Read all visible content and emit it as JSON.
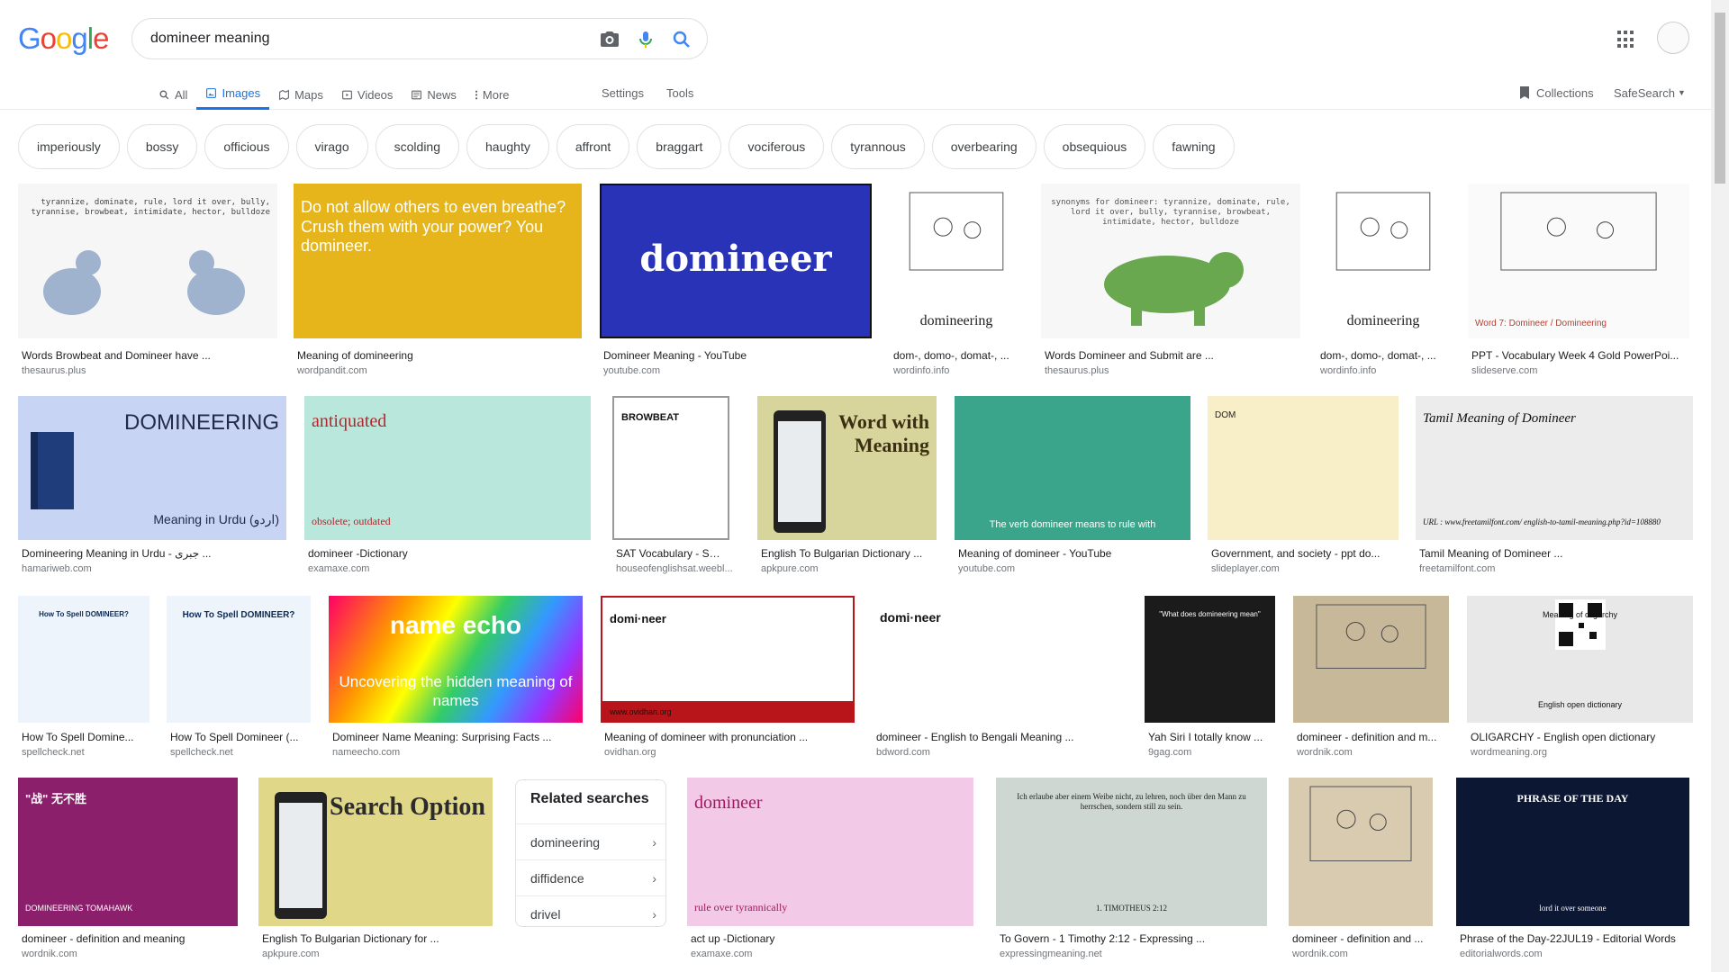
{
  "logo": [
    "G",
    "o",
    "o",
    "g",
    "l",
    "e"
  ],
  "logo_colors": [
    "#4285f4",
    "#ea4335",
    "#fbbc05",
    "#4285f4",
    "#34a853",
    "#ea4335"
  ],
  "search": {
    "query": "domineer meaning"
  },
  "tabs": [
    {
      "label": "All",
      "icon": "search-icon"
    },
    {
      "label": "Images",
      "icon": "image-icon"
    },
    {
      "label": "Maps",
      "icon": "map-icon"
    },
    {
      "label": "Videos",
      "icon": "video-icon"
    },
    {
      "label": "News",
      "icon": "news-icon"
    },
    {
      "label": "More",
      "icon": "more-icon"
    }
  ],
  "tools": {
    "settings": "Settings",
    "tools": "Tools",
    "collections": "Collections",
    "safesearch": "SafeSearch"
  },
  "chips": [
    "imperiously",
    "bossy",
    "officious",
    "virago",
    "scolding",
    "haughty",
    "affront",
    "braggart",
    "vociferous",
    "tyrannous",
    "overbearing",
    "obsequious",
    "fawning"
  ],
  "row1": [
    {
      "caption": "Words Browbeat and Domineer have ...",
      "source": "thesaurus.plus",
      "text": "tyrannize, dominate, rule, lord it over, bully, tyrannise, browbeat, intimidate, hector, bulldoze"
    },
    {
      "caption": "Meaning of domineering",
      "source": "wordpandit.com",
      "text": "Do not allow others to even breathe? Crush them with your power? You domineer."
    },
    {
      "caption": "Domineer Meaning - YouTube",
      "source": "youtube.com",
      "text": "domineer"
    },
    {
      "caption": "dom-, domo-, domat-, ...",
      "source": "wordinfo.info",
      "text": "domineering"
    },
    {
      "caption": "Words Domineer and Submit are ...",
      "source": "thesaurus.plus",
      "text": "synonyms for domineer: tyrannize, dominate, rule, lord it over, bully, tyrannise, browbeat, intimidate, hector, bulldoze"
    },
    {
      "caption": "dom-, domo-, domat-, ...",
      "source": "wordinfo.info",
      "text": "domineering"
    },
    {
      "caption": "PPT - Vocabulary Week 4 Gold PowerPoi...",
      "source": "slideserve.com",
      "text": "Word 7: Domineer / Domineering"
    }
  ],
  "row2": [
    {
      "caption": "Domineering Meaning in Urdu - جبری ...",
      "source": "hamariweb.com",
      "text": "DOMINEERING",
      "text2": "Meaning in Urdu (اردو)"
    },
    {
      "caption": "domineer -Dictionary",
      "source": "examaxe.com",
      "text": "antiquated",
      "text2": "obsolete; outdated"
    },
    {
      "caption": "SAT Vocabulary - SAT...",
      "source": "houseofenglishsat.weebl...",
      "text": "BROWBEAT"
    },
    {
      "caption": "English To Bulgarian Dictionary ...",
      "source": "apkpure.com",
      "text": "Word with Meaning"
    },
    {
      "caption": "Meaning of domineer - YouTube",
      "source": "youtube.com",
      "text": "The verb domineer means to rule with"
    },
    {
      "caption": "Government, and society - ppt do...",
      "source": "slideplayer.com",
      "text": "DOM"
    },
    {
      "caption": "Tamil Meaning of Domineer ...",
      "source": "freetamilfont.com",
      "text": "Tamil Meaning of Domineer",
      "text2": "URL : www.freetamilfont.com/ english-to-tamil-meaning.php?id=108880"
    }
  ],
  "row3": [
    {
      "caption": "How To Spell Domine...",
      "source": "spellcheck.net",
      "text": "How To Spell DOMINEER?"
    },
    {
      "caption": "How To Spell Domineer (...",
      "source": "spellcheck.net",
      "text": "How To Spell DOMINEER?"
    },
    {
      "caption": "Domineer Name Meaning: Surprising Facts ...",
      "source": "nameecho.com",
      "text": "name echo",
      "text2": "Uncovering the hidden meaning of names"
    },
    {
      "caption": "Meaning of domineer with pronunciation ...",
      "source": "ovidhan.org",
      "text": "domi·neer",
      "text2": "www.ovidhan.org"
    },
    {
      "caption": "domineer - English to Bengali Meaning ...",
      "source": "bdword.com",
      "text": "domi·neer"
    },
    {
      "caption": "Yah Siri I totally know ...",
      "source": "9gag.com",
      "text": "\"What does domineering mean\""
    },
    {
      "caption": "domineer - definition and m...",
      "source": "wordnik.com",
      "text": ""
    },
    {
      "caption": "OLIGARCHY - English open dictionary",
      "source": "wordmeaning.org",
      "text": "Meaning of oligarchy",
      "text2": "English open dictionary"
    }
  ],
  "row4": [
    {
      "caption": "domineer - definition and meaning",
      "source": "wordnik.com",
      "text": "\"战\" 无不胜",
      "text2": "DOMINEERING TOMAHAWK"
    },
    {
      "caption": "English To Bulgarian Dictionary for ...",
      "source": "apkpure.com",
      "text": "Search Option"
    },
    {
      "caption": "act up -Dictionary",
      "source": "examaxe.com",
      "text": "domineer",
      "text2": "rule over tyrannically"
    },
    {
      "caption": "To Govern - 1 Timothy 2:12 - Expressing ...",
      "source": "expressingmeaning.net",
      "text": "Ich erlaube aber einem Weibe nicht, zu lehren, noch über den Mann zu herrschen, sondern still zu sein.",
      "text2": "1. TIMOTHEUS 2:12"
    },
    {
      "caption": "domineer - definition and ...",
      "source": "wordnik.com",
      "text": ""
    },
    {
      "caption": "Phrase of the Day-22JUL19 - Editorial Words",
      "source": "editorialwords.com",
      "text": "PHRASE OF THE DAY",
      "text2": "lord it over someone"
    }
  ],
  "related": {
    "title": "Related searches",
    "items": [
      "domineering",
      "diffidence",
      "drivel"
    ]
  }
}
